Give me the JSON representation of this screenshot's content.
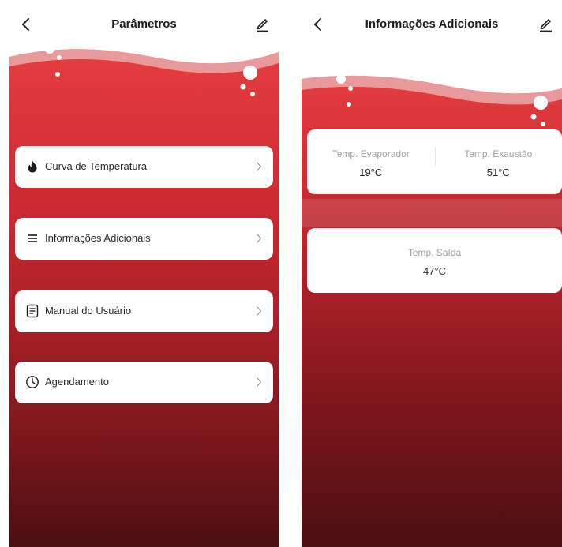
{
  "left_screen": {
    "title": "Parâmetros",
    "menu": [
      {
        "label": "Curva de Temperatura",
        "icon": "flame-icon"
      },
      {
        "label": "Informações Adicionais",
        "icon": "list-icon"
      },
      {
        "label": "Manual do Usuário",
        "icon": "document-icon"
      },
      {
        "label": "Agendamento",
        "icon": "clock-icon"
      }
    ]
  },
  "right_screen": {
    "title": "Informações Adicionais",
    "card1": {
      "left": {
        "label": "Temp. Evaporador",
        "value": "19°C"
      },
      "right": {
        "label": "Temp. Exaustão",
        "value": "51°C"
      }
    },
    "card2": {
      "label": "Temp. Saída",
      "value": "47°C"
    }
  },
  "colors": {
    "accent_top": "#e23a3d",
    "accent_bottom": "#4d1013",
    "wave_highlight": "#eaa9aa"
  }
}
